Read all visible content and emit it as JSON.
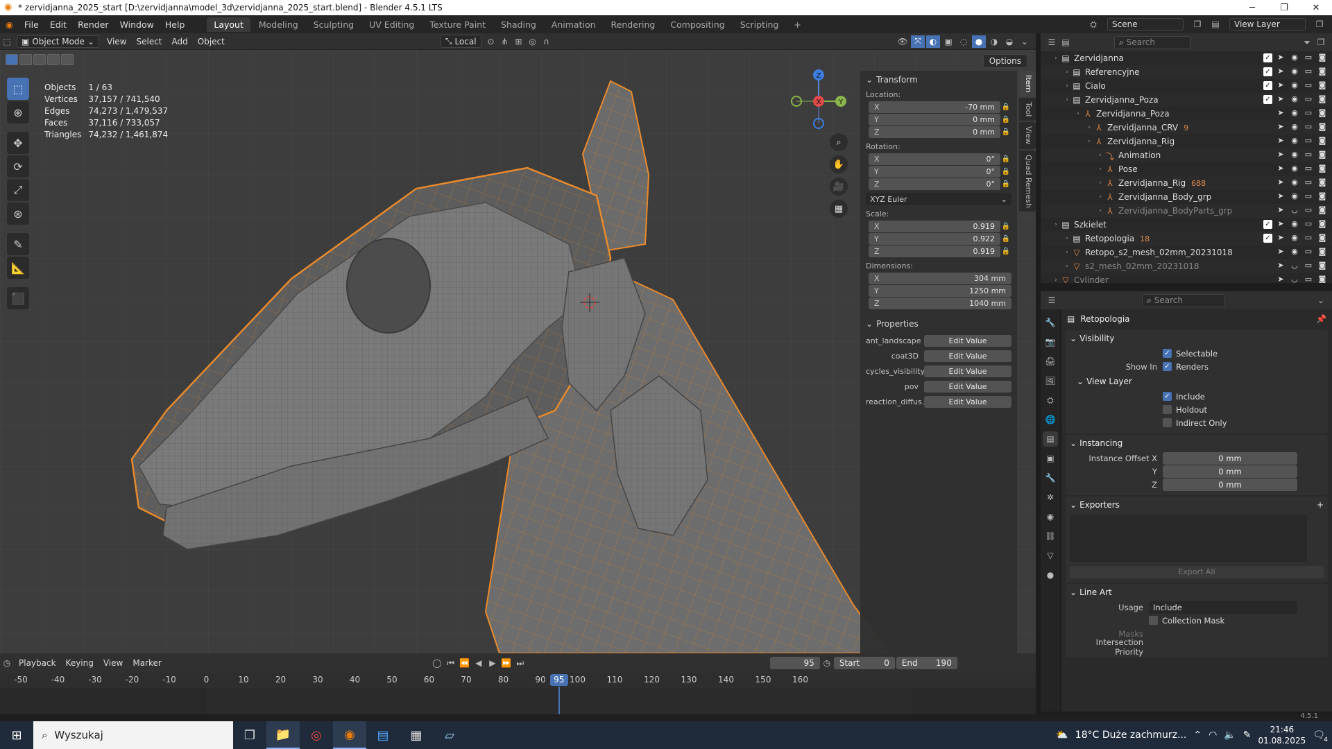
{
  "window": {
    "title": "* zervidjanna_2025_start [D:\\zervidjanna\\model_3d\\zervidjanna_2025_start.blend] - Blender 4.5.1 LTS",
    "minimize": "─",
    "maximize": "❐",
    "close": "✕"
  },
  "menu": {
    "items": [
      "File",
      "Edit",
      "Render",
      "Window",
      "Help"
    ]
  },
  "workspaces": {
    "active": "Layout",
    "tabs": [
      "Layout",
      "Modeling",
      "Sculpting",
      "UV Editing",
      "Texture Paint",
      "Shading",
      "Animation",
      "Rendering",
      "Compositing",
      "Scripting"
    ],
    "add": "+"
  },
  "scene": {
    "label": "Scene",
    "view_layer": "View Layer"
  },
  "viewport_header": {
    "mode": "Object Mode",
    "menus": [
      "View",
      "Select",
      "Add",
      "Object"
    ],
    "orientation": "Local",
    "options": "Options"
  },
  "stats": {
    "rows": [
      {
        "label": "Objects",
        "value": "1 / 63"
      },
      {
        "label": "Vertices",
        "value": "37,157 / 741,540"
      },
      {
        "label": "Edges",
        "value": "74,273 / 1,479,537"
      },
      {
        "label": "Faces",
        "value": "37,116 / 733,057"
      },
      {
        "label": "Triangles",
        "value": "74,232 / 1,461,874"
      }
    ]
  },
  "gizmo": {
    "z": "Z",
    "x": "X",
    "y": "Y"
  },
  "npanel": {
    "tabs": [
      "Item",
      "Tool",
      "View",
      "Quad Remesh"
    ],
    "transform": {
      "title": "Transform",
      "location_label": "Location:",
      "location": [
        {
          "axis": "X",
          "value": "-70 mm"
        },
        {
          "axis": "Y",
          "value": "0 mm"
        },
        {
          "axis": "Z",
          "value": "0 mm"
        }
      ],
      "rotation_label": "Rotation:",
      "rotation": [
        {
          "axis": "X",
          "value": "0°"
        },
        {
          "axis": "Y",
          "value": "0°"
        },
        {
          "axis": "Z",
          "value": "0°"
        }
      ],
      "rotation_mode": "XYZ Euler",
      "scale_label": "Scale:",
      "scale": [
        {
          "axis": "X",
          "value": "0.919"
        },
        {
          "axis": "Y",
          "value": "0.922"
        },
        {
          "axis": "Z",
          "value": "0.919"
        }
      ],
      "dimensions_label": "Dimensions:",
      "dimensions": [
        {
          "axis": "X",
          "value": "304 mm"
        },
        {
          "axis": "Y",
          "value": "1250 mm"
        },
        {
          "axis": "Z",
          "value": "1040 mm"
        }
      ]
    },
    "properties": {
      "title": "Properties",
      "items": [
        {
          "name": "ant_landscape",
          "button": "Edit Value"
        },
        {
          "name": "coat3D",
          "button": "Edit Value"
        },
        {
          "name": "cycles_visibility",
          "button": "Edit Value"
        },
        {
          "name": "pov",
          "button": "Edit Value"
        },
        {
          "name": "reaction_diffus...",
          "button": "Edit Value"
        }
      ]
    }
  },
  "outliner": {
    "search_placeholder": "Search",
    "rows": [
      {
        "indent": 1,
        "icon": "collection-icon",
        "name": "Zervidjanna",
        "extra": "",
        "dim": false
      },
      {
        "indent": 2,
        "icon": "collection-icon",
        "name": "Referencyjne",
        "extra": "",
        "dim": false
      },
      {
        "indent": 2,
        "icon": "collection-icon",
        "name": "Cialo",
        "extra": "",
        "dim": false
      },
      {
        "indent": 2,
        "icon": "collection-icon",
        "name": "Zervidjanna_Poza",
        "extra": "",
        "dim": false
      },
      {
        "indent": 3,
        "icon": "armature-icon",
        "name": "Zervidjanna_Poza",
        "extra": "",
        "dim": false
      },
      {
        "indent": 4,
        "icon": "armature-icon",
        "name": "Zervidjanna_CRV",
        "extra": "9",
        "dim": false
      },
      {
        "indent": 4,
        "icon": "armature-icon",
        "name": "Zervidjanna_Rig",
        "extra": "",
        "dim": false
      },
      {
        "indent": 5,
        "icon": "animation-icon",
        "name": "Animation",
        "extra": "",
        "dim": false
      },
      {
        "indent": 5,
        "icon": "pose-icon",
        "name": "Pose",
        "extra": "",
        "dim": false
      },
      {
        "indent": 5,
        "icon": "armature-data-icon",
        "name": "Zervidjanna_Rig",
        "extra": "688",
        "dim": false
      },
      {
        "indent": 5,
        "icon": "armature-icon",
        "name": "Zervidjanna_Body_grp",
        "extra": "",
        "dim": false
      },
      {
        "indent": 5,
        "icon": "armature-icon",
        "name": "Zervidjanna_BodyParts_grp",
        "extra": "",
        "dim": true
      },
      {
        "indent": 1,
        "icon": "collection-icon",
        "name": "Szkielet",
        "extra": "",
        "dim": false
      },
      {
        "indent": 2,
        "icon": "collection-icon",
        "name": "Retopologia",
        "extra": "18",
        "dim": false
      },
      {
        "indent": 2,
        "icon": "mesh-icon",
        "name": "Retopo_s2_mesh_02mm_20231018",
        "extra": "",
        "dim": false
      },
      {
        "indent": 2,
        "icon": "mesh-icon",
        "name": "s2_mesh_02mm_20231018",
        "extra": "",
        "dim": true
      },
      {
        "indent": 1,
        "icon": "mesh-icon",
        "name": "Cylinder",
        "extra": "",
        "dim": true
      }
    ]
  },
  "properties": {
    "search_placeholder": "Search",
    "object_name": "Retopologia",
    "visibility": {
      "title": "Visibility",
      "selectable": "Selectable",
      "show_in": "Show In",
      "renders": "Renders"
    },
    "view_layer": {
      "title": "View Layer",
      "include": "Include",
      "holdout": "Holdout",
      "indirect_only": "Indirect Only"
    },
    "instancing": {
      "title": "Instancing",
      "offset_x_label": "Instance Offset X",
      "y_label": "Y",
      "z_label": "Z",
      "x": "0 mm",
      "y": "0 mm",
      "z": "0 mm"
    },
    "exporters": {
      "title": "Exporters",
      "export_all": "Export All"
    },
    "line_art": {
      "title": "Line Art",
      "usage_label": "Usage",
      "usage": "Include",
      "collection_mask": "Collection Mask",
      "masks": "Masks",
      "intersection_priority": "Intersection Priority"
    }
  },
  "timeline": {
    "menus": [
      "Playback",
      "Keying",
      "View",
      "Marker"
    ],
    "current_frame": "95",
    "start_label": "Start",
    "start": "0",
    "end_label": "End",
    "end": "190",
    "ruler": [
      "-50",
      "-40",
      "-30",
      "-20",
      "-10",
      "0",
      "10",
      "20",
      "30",
      "40",
      "50",
      "60",
      "70",
      "80",
      "90",
      "95",
      "100",
      "110",
      "120",
      "130",
      "140",
      "150",
      "160"
    ]
  },
  "statusbar": {
    "version": "4.5.1"
  },
  "taskbar": {
    "search_placeholder": "Wyszukaj",
    "weather": "18°C  Duże zachmurz...",
    "time": "21:46",
    "date": "01.08.2025",
    "notifications": "4"
  },
  "colors": {
    "accent": "#4772b3",
    "selection_orange": "#e98a2c",
    "viewport_bg": "#3d3d3d"
  }
}
